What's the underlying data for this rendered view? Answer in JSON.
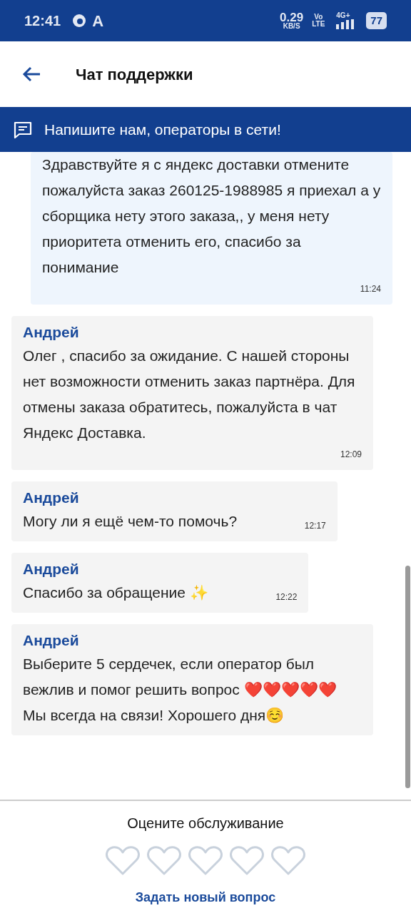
{
  "status_bar": {
    "time": "12:41",
    "letter": "A",
    "speed": "0.29",
    "speed_unit": "KB/S",
    "volte_top": "Vo",
    "volte_bottom": "LTE",
    "network": "4G+",
    "battery": "77"
  },
  "header": {
    "title": "Чат поддержки"
  },
  "banner": {
    "text": "Напишите нам, операторы в сети!"
  },
  "messages": [
    {
      "kind": "user",
      "text": "Здравствуйте я с яндекс доставки отмените пожалуйста заказ 260125-1988985 я приехал а у сборщика нету этого заказа,, у меня нету приоритета отменить его, спасибо за понимание",
      "time": "11:24"
    },
    {
      "kind": "operator",
      "author": "Андрей",
      "text": "Олег , спасибо за ожидание. С нашей стороны нет возможности отменить заказ партнёра. Для отмены заказа обратитесь, пожалуйста в чат Яндекс Доставка.",
      "time": "12:09"
    },
    {
      "kind": "operator",
      "author": "Андрей",
      "text": "Могу ли я ещё чем-то помочь?",
      "time": "12:17"
    },
    {
      "kind": "operator",
      "author": "Андрей",
      "text": "Спасибо за обращение ✨",
      "time": "12:22"
    },
    {
      "kind": "operator",
      "author": "Андрей",
      "text": "Выберите 5 сердечек, если оператор был вежлив и помог решить вопрос ❤️❤️❤️❤️❤️\nМы всегда на связи! Хорошего дня☺️"
    }
  ],
  "rating": {
    "title": "Оцените обслуживание",
    "stars": 0,
    "link": "Задать новый вопрос"
  }
}
